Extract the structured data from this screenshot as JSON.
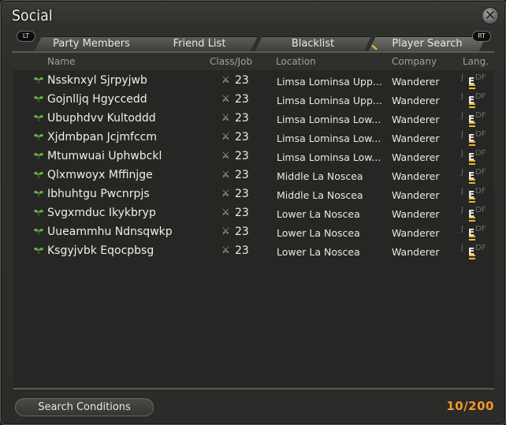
{
  "window": {
    "title": "Social"
  },
  "tabs": [
    {
      "label": "Party Members"
    },
    {
      "label": "Friend List"
    },
    {
      "label": "Blacklist"
    },
    {
      "label": "Player Search"
    }
  ],
  "shoulders": {
    "left": "LT",
    "right": "RT"
  },
  "columns": {
    "name": "Name",
    "class_job": "Class/Job",
    "location": "Location",
    "company": "Company",
    "lang": "Lang."
  },
  "lang_letters": {
    "j": "J",
    "e": "E",
    "df": "DF"
  },
  "rows": [
    {
      "name": "Nssknxyl Sjrpyjwb",
      "level": "23",
      "location": "Limsa Lominsa Upp...",
      "company": "Wanderer"
    },
    {
      "name": "Gojnlljq Hgyccedd",
      "level": "23",
      "location": "Limsa Lominsa Upp...",
      "company": "Wanderer"
    },
    {
      "name": "Ubuphdvv Kultoddd",
      "level": "23",
      "location": "Limsa Lominsa Low...",
      "company": "Wanderer"
    },
    {
      "name": "Xjdmbpan Jcjmfccm",
      "level": "23",
      "location": "Limsa Lominsa Low...",
      "company": "Wanderer"
    },
    {
      "name": "Mtumwuai Uphwbckl",
      "level": "23",
      "location": "Limsa Lominsa Low...",
      "company": "Wanderer"
    },
    {
      "name": "Qlxmwoyx Mffinjge",
      "level": "23",
      "location": "Middle La Noscea",
      "company": "Wanderer"
    },
    {
      "name": "Ibhuhtgu Pwcnrpjs",
      "level": "23",
      "location": "Middle La Noscea",
      "company": "Wanderer"
    },
    {
      "name": "Svgxmduc Ikykbryp",
      "level": "23",
      "location": "Lower La Noscea",
      "company": "Wanderer"
    },
    {
      "name": "Uueammhu Ndnsqwkp",
      "level": "23",
      "location": "Lower La Noscea",
      "company": "Wanderer"
    },
    {
      "name": "Ksgyjvbk Eqocpbsg",
      "level": "23",
      "location": "Lower La Noscea",
      "company": "Wanderer"
    }
  ],
  "footer": {
    "search_label": "Search Conditions",
    "count": "10/200"
  },
  "icons": {
    "row_marker": "sprout-icon",
    "job": "gladiator-job-icon",
    "close": "close-icon"
  },
  "colors": {
    "accent_orange": "#f29a2a",
    "marker_green": "#7cc25a",
    "highlight_gold": "#e8b83a"
  }
}
